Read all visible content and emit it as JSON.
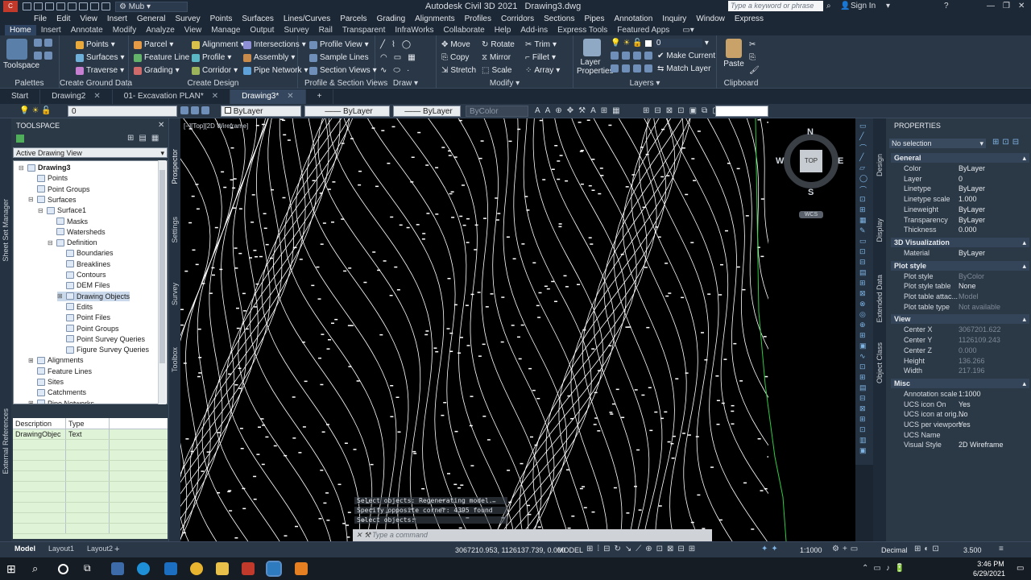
{
  "app": {
    "title": "Autodesk Civil 3D 2021",
    "file": "Drawing3.dwg",
    "workspace": "Mub",
    "search_placeholder": "Type a keyword or phrase",
    "sign_in": "Sign In"
  },
  "menu": [
    "File",
    "Edit",
    "View",
    "Insert",
    "General",
    "Survey",
    "Points",
    "Surfaces",
    "Lines/Curves",
    "Parcels",
    "Grading",
    "Alignments",
    "Profiles",
    "Corridors",
    "Sections",
    "Pipes",
    "Annotation",
    "Inquiry",
    "Window",
    "Express"
  ],
  "ribbon_tabs": [
    "Home",
    "Insert",
    "Annotate",
    "Modify",
    "Analyze",
    "View",
    "Manage",
    "Output",
    "Survey",
    "Rail",
    "Transparent",
    "InfraWorks",
    "Collaborate",
    "Help",
    "Add-ins",
    "Express Tools",
    "Featured Apps"
  ],
  "ribbon": {
    "toolspace_label": "Toolspace",
    "palettes": "Palettes",
    "ground": {
      "title": "Create Ground Data",
      "items": [
        "Points",
        "Surfaces",
        "Traverse"
      ]
    },
    "design": {
      "title": "Create Design",
      "items": [
        "Parcel",
        "Feature Line",
        "Grading",
        "Alignment",
        "Profile",
        "Corridor",
        "Intersections",
        "Assembly",
        "Pipe Network"
      ]
    },
    "profsec": {
      "title": "Profile & Section Views",
      "items": [
        "Profile View",
        "Sample Lines",
        "Section Views"
      ]
    },
    "draw": {
      "title": "Draw"
    },
    "modify": {
      "title": "Modify",
      "items": [
        "Move",
        "Copy",
        "Stretch",
        "Rotate",
        "Mirror",
        "Scale",
        "Trim",
        "Fillet",
        "Array"
      ]
    },
    "layers": {
      "title": "Layers",
      "layer_properties": "Layer Properties",
      "current_layer": "0",
      "make_current": "Make Current",
      "match_layer": "Match Layer"
    },
    "clipboard": {
      "title": "Clipboard",
      "paste": "Paste"
    }
  },
  "file_tabs": [
    {
      "label": "Start",
      "active": false
    },
    {
      "label": "Drawing2",
      "active": false
    },
    {
      "label": "01- Excavation PLAN*",
      "active": false
    },
    {
      "label": "Drawing3*",
      "active": true
    }
  ],
  "propbar": {
    "layer": "0",
    "color": "ByLayer",
    "linetype": "ByLayer",
    "lineweight": "ByLayer",
    "plotstyle": "ByColor"
  },
  "toolspace": {
    "title": "TOOLSPACE",
    "view": "Active Drawing View",
    "side_tabs": [
      "Prospector",
      "Settings",
      "Survey",
      "Toolbox"
    ],
    "tree": [
      {
        "label": "Drawing3",
        "lvl": 0,
        "bold": true
      },
      {
        "label": "Points",
        "lvl": 1
      },
      {
        "label": "Point Groups",
        "lvl": 1
      },
      {
        "label": "Surfaces",
        "lvl": 1
      },
      {
        "label": "Surface1",
        "lvl": 2
      },
      {
        "label": "Masks",
        "lvl": 3
      },
      {
        "label": "Watersheds",
        "lvl": 3
      },
      {
        "label": "Definition",
        "lvl": 3
      },
      {
        "label": "Boundaries",
        "lvl": 4
      },
      {
        "label": "Breaklines",
        "lvl": 4
      },
      {
        "label": "Contours",
        "lvl": 4
      },
      {
        "label": "DEM Files",
        "lvl": 4
      },
      {
        "label": "Drawing Objects",
        "lvl": 4,
        "sel": true
      },
      {
        "label": "Edits",
        "lvl": 4
      },
      {
        "label": "Point Files",
        "lvl": 4
      },
      {
        "label": "Point Groups",
        "lvl": 4
      },
      {
        "label": "Point Survey Queries",
        "lvl": 4
      },
      {
        "label": "Figure Survey Queries",
        "lvl": 4
      },
      {
        "label": "Alignments",
        "lvl": 1
      },
      {
        "label": "Feature Lines",
        "lvl": 1
      },
      {
        "label": "Sites",
        "lvl": 1
      },
      {
        "label": "Catchments",
        "lvl": 1
      },
      {
        "label": "Pipe Networks",
        "lvl": 1
      }
    ],
    "table_headers": [
      "Description",
      "Type"
    ],
    "table_rows": [
      [
        "DrawingObjec",
        "Text"
      ]
    ]
  },
  "left_palettes": [
    "Sheet Set Manager",
    "External References"
  ],
  "viewport": {
    "label": "[−][Top][2D Wireframe]",
    "compass": {
      "n": "N",
      "s": "S",
      "e": "E",
      "w": "W",
      "top": "TOP",
      "wcs": "WCS"
    },
    "command_history": [
      "Select objects: Regenerating model.",
      "Specify opposite corner: 4395 found",
      "Select objects:"
    ],
    "command_placeholder": "Type a command"
  },
  "properties": {
    "title": "PROPERTIES",
    "selection": "No selection",
    "side_tabs": [
      "Design",
      "Display",
      "Extended Data",
      "Object Class"
    ],
    "sections": [
      {
        "name": "General",
        "rows": [
          [
            "Color",
            "ByLayer"
          ],
          [
            "Layer",
            "0"
          ],
          [
            "Linetype",
            "ByLayer"
          ],
          [
            "Linetype scale",
            "1.000"
          ],
          [
            "Lineweight",
            "ByLayer"
          ],
          [
            "Transparency",
            "ByLayer"
          ],
          [
            "Thickness",
            "0.000"
          ]
        ]
      },
      {
        "name": "3D Visualization",
        "rows": [
          [
            "Material",
            "ByLayer"
          ]
        ]
      },
      {
        "name": "Plot style",
        "rows": [
          [
            "Plot style",
            "ByColor"
          ],
          [
            "Plot style table",
            "None"
          ],
          [
            "Plot table attac...",
            "Model"
          ],
          [
            "Plot table type",
            "Not available"
          ]
        ]
      },
      {
        "name": "View",
        "rows": [
          [
            "Center X",
            "3067201.622"
          ],
          [
            "Center Y",
            "1126109.243"
          ],
          [
            "Center Z",
            "0.000"
          ],
          [
            "Height",
            "136.266"
          ],
          [
            "Width",
            "217.196"
          ]
        ]
      },
      {
        "name": "Misc",
        "rows": [
          [
            "Annotation scale",
            "1:1000"
          ],
          [
            "UCS icon On",
            "Yes"
          ],
          [
            "UCS icon at orig...",
            "No"
          ],
          [
            "UCS per viewport",
            "Yes"
          ],
          [
            "UCS Name",
            ""
          ],
          [
            "Visual Style",
            "2D Wireframe"
          ]
        ]
      }
    ]
  },
  "status": {
    "tabs": [
      "Model",
      "Layout1",
      "Layout2"
    ],
    "coords": "3067210.953, 1126137.739, 0.000",
    "model": "MODEL",
    "scale": "1:1000",
    "units": "Decimal",
    "value": "3.500"
  },
  "taskbar": {
    "time": "3:46 PM",
    "date": "6/29/2021"
  },
  "colors": {
    "canvas": "#000000",
    "contour": "#ffffff",
    "boundary": "#2ecc40",
    "chrome": "#2a3747"
  }
}
